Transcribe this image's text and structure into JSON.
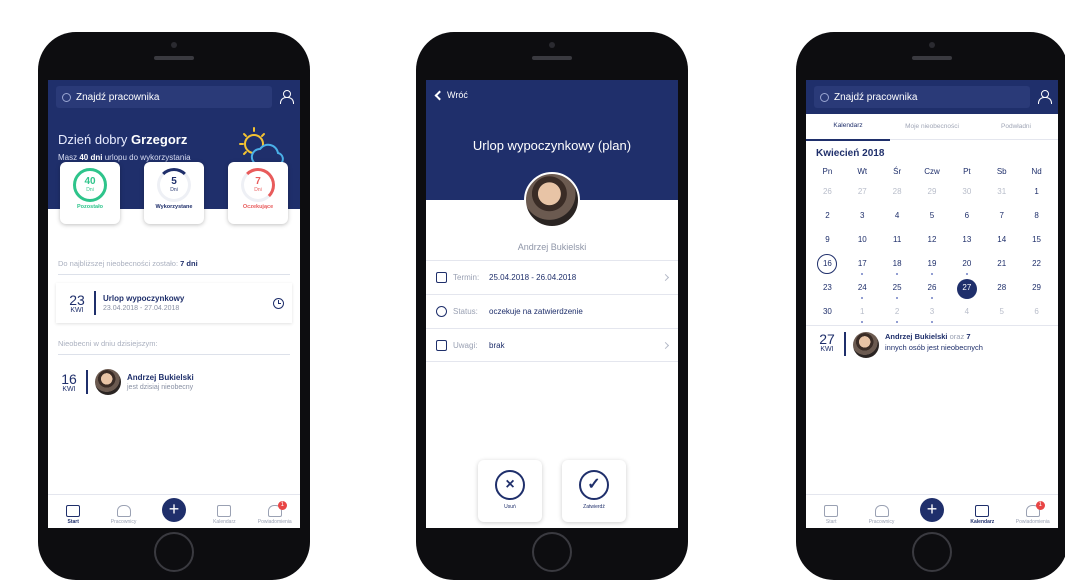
{
  "screen1": {
    "search_placeholder": "Znajdź pracownika",
    "greeting_prefix": "Dzień dobry",
    "user_name": "Grzegorz",
    "sub_prefix": "Masz",
    "sub_days": "40 dni",
    "sub_suffix": "urlopu do wykorzystania",
    "stats": [
      {
        "value": "40",
        "unit": "Dni",
        "label": "Pozostało"
      },
      {
        "value": "5",
        "unit": "Dni",
        "label": "Wykorzystane"
      },
      {
        "value": "7",
        "unit": "Dni",
        "label": "Oczekujące"
      }
    ],
    "next_absence_text": "Do najbliższej nieobecności zostało:",
    "next_absence_days": "7 dni",
    "leave": {
      "day": "23",
      "month": "KWI",
      "title": "Urlop wypoczynkowy",
      "range": "23.04.2018 - 27.04.2018"
    },
    "absent_today_label": "Nieobecni w dniu dzisiejszym:",
    "absent": {
      "day": "16",
      "month": "KWI",
      "name": "Andrzej Bukielski",
      "status": "jest dzisiaj nieobecny"
    },
    "tabs": [
      "Start",
      "Pracownicy",
      "Kalendarz",
      "Powiadomienia"
    ],
    "badge": "1"
  },
  "screen2": {
    "back_label": "Wróć",
    "title": "Urlop wypoczynkowy (plan)",
    "person": "Andrzej Bukielski",
    "rows": [
      {
        "key": "Termin:",
        "value": "25.04.2018 - 26.04.2018"
      },
      {
        "key": "Status:",
        "value": "oczekuje na zatwierdzenie"
      },
      {
        "key": "Uwagi:",
        "value": "brak"
      }
    ],
    "delete_label": "Usuń",
    "approve_label": "Zatwierdź"
  },
  "screen3": {
    "search_placeholder": "Znajdź pracownika",
    "tabs": [
      "Kalendarz",
      "Moje nieobecności",
      "Podwładni"
    ],
    "month": "Kwiecień  2018",
    "weekdays": [
      "Pn",
      "Wt",
      "Śr",
      "Czw",
      "Pt",
      "Sb",
      "Nd"
    ],
    "days": [
      [
        "26",
        "27",
        "28",
        "29",
        "30",
        "31",
        "1"
      ],
      [
        "2",
        "3",
        "4",
        "5",
        "6",
        "7",
        "8"
      ],
      [
        "9",
        "10",
        "11",
        "12",
        "13",
        "14",
        "15"
      ],
      [
        "16",
        "17",
        "18",
        "19",
        "20",
        "21",
        "22"
      ],
      [
        "23",
        "24",
        "25",
        "26",
        "27",
        "28",
        "29"
      ],
      [
        "30",
        "1",
        "2",
        "3",
        "4",
        "5",
        "6"
      ]
    ],
    "absent": {
      "day": "27",
      "month": "KWI",
      "name": "Andrzej Bukielski",
      "mid": "oraz",
      "count": "7",
      "rest": "innych osób jest nieobecnych"
    },
    "tabbar": [
      "Start",
      "Pracownicy",
      "Kalendarz",
      "Powiadomienia"
    ],
    "badge": "1"
  }
}
